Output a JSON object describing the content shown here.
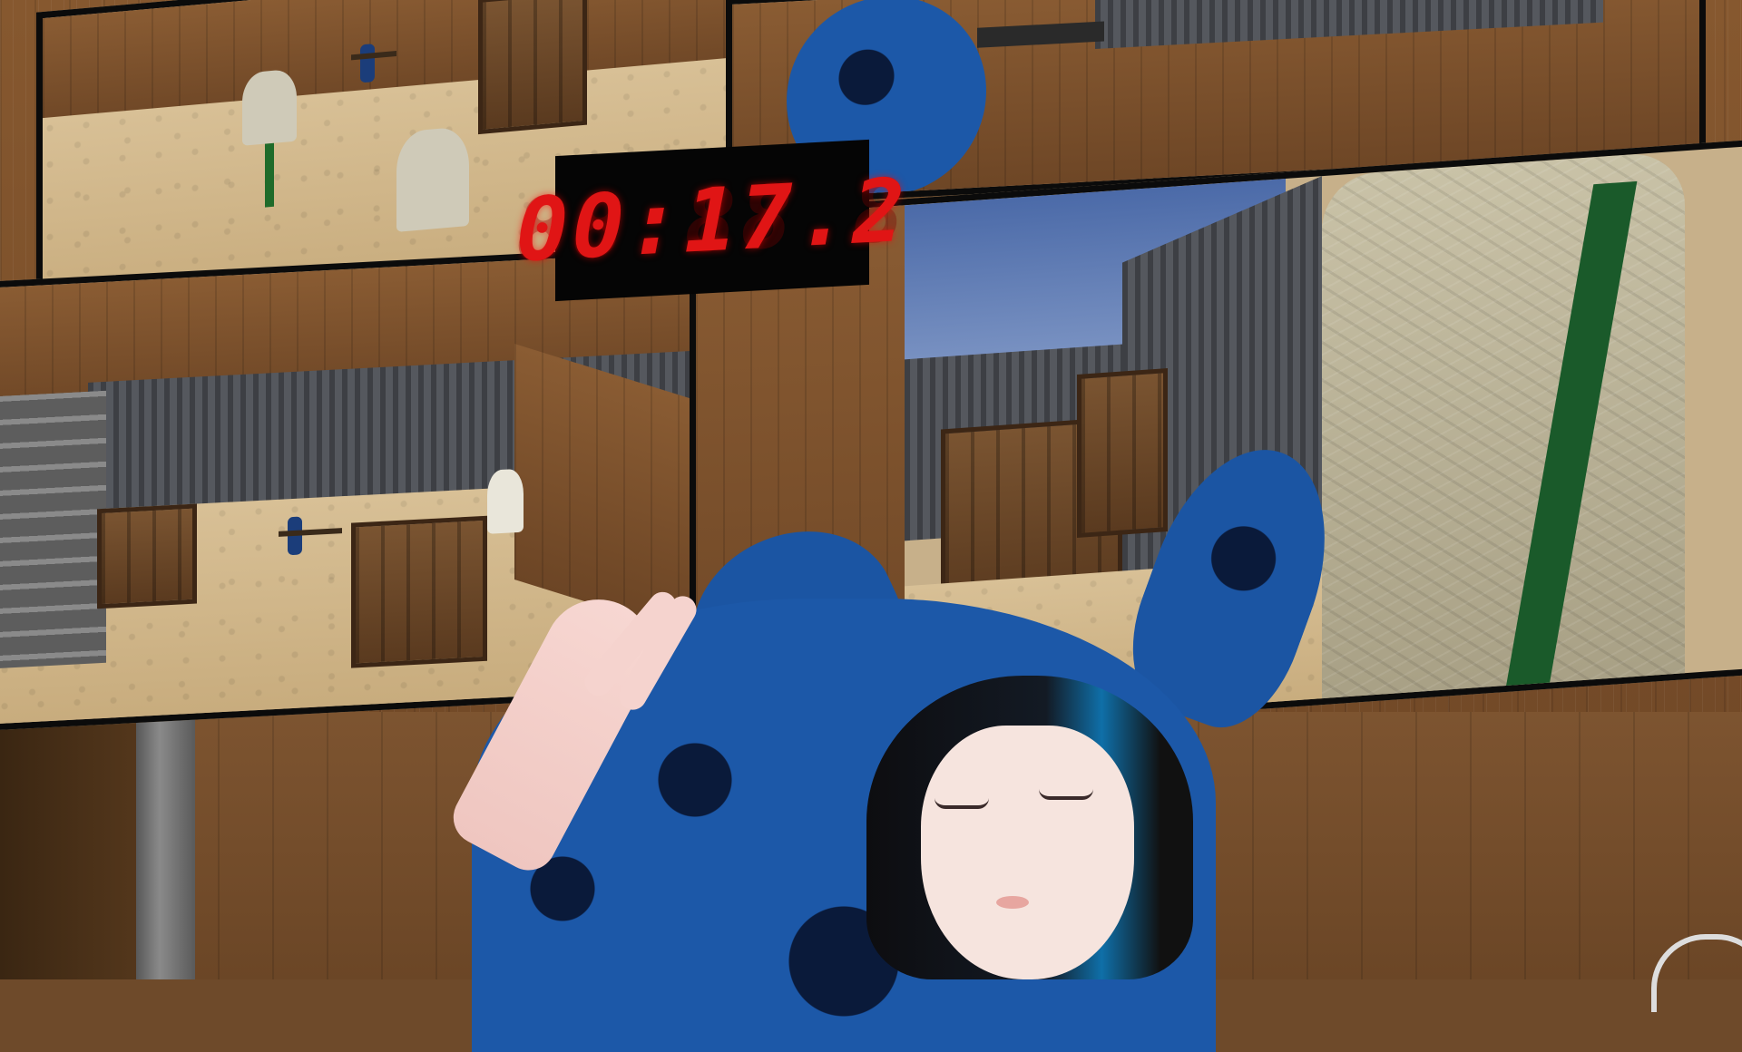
{
  "hud": {
    "timer_display": "00:17.2",
    "timer_ghost": "88:88.8",
    "timer_color": "#e01515"
  },
  "scene": {
    "palette": {
      "wood": "#7a4f2a",
      "sand": "#d8c096",
      "sky": "#4b6aa8",
      "container": "#3d3f44",
      "fur_blue": "#1c58a8",
      "target_stand": "#1f6b2a"
    },
    "icons": [
      "timer-display",
      "avatar",
      "target",
      "crate"
    ]
  }
}
